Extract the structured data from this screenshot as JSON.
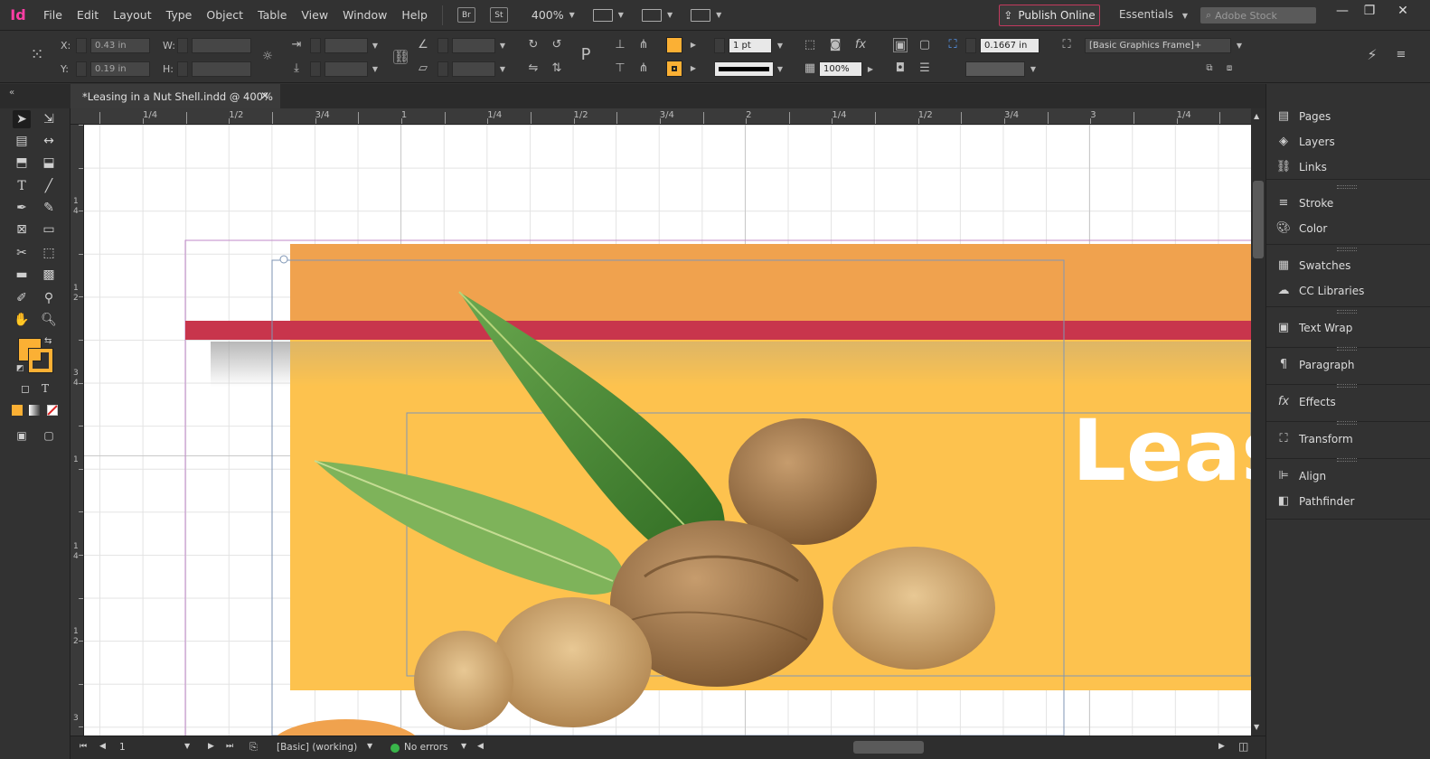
{
  "app": {
    "logo": "Id"
  },
  "menu": [
    "File",
    "Edit",
    "Layout",
    "Type",
    "Object",
    "Table",
    "View",
    "Window",
    "Help"
  ],
  "toolbar_top": {
    "bridge": "Br",
    "stock": "St",
    "zoom": "400%",
    "publish_label": "Publish Online",
    "workspace": "Essentials",
    "search_placeholder": "Adobe Stock"
  },
  "control": {
    "x_label": "X:",
    "y_label": "Y:",
    "w_label": "W:",
    "h_label": "H:",
    "x_value": "0.43 in",
    "y_value": "0.19 in",
    "stroke_weight": "1 pt",
    "opacity": "100%",
    "offset": "0.1667 in",
    "object_style": "[Basic Graphics Frame]+",
    "fill_color": "#fbb034"
  },
  "document": {
    "tab_title": "*Leasing in a Nut Shell.indd @ 400%",
    "canvas_text": "Leas"
  },
  "rulers": {
    "h_labels": [
      "1/4",
      "1/2",
      "3/4",
      "1",
      "1/4",
      "1/2",
      "3/4",
      "2",
      "1/4",
      "1/2",
      "3/4",
      "3",
      "1/4"
    ],
    "v_labels": [
      "1\n4",
      "1\n2",
      "3\n4",
      "1",
      "1\n4",
      "1\n2",
      "3"
    ]
  },
  "status": {
    "page": "1",
    "style": "[Basic] (working)",
    "preflight": "No errors",
    "preflight_color": "#39b54a"
  },
  "panels": [
    {
      "group": [
        {
          "label": "Pages",
          "icon": "pages-icon"
        },
        {
          "label": "Layers",
          "icon": "layers-icon"
        },
        {
          "label": "Links",
          "icon": "links-icon"
        }
      ]
    },
    {
      "group": [
        {
          "label": "Stroke",
          "icon": "stroke-icon"
        },
        {
          "label": "Color",
          "icon": "color-icon"
        }
      ]
    },
    {
      "group": [
        {
          "label": "Swatches",
          "icon": "swatches-icon"
        },
        {
          "label": "CC Libraries",
          "icon": "cc-libraries-icon"
        }
      ]
    },
    {
      "group": [
        {
          "label": "Text Wrap",
          "icon": "text-wrap-icon"
        }
      ]
    },
    {
      "group": [
        {
          "label": "Paragraph",
          "icon": "paragraph-icon"
        }
      ]
    },
    {
      "group": [
        {
          "label": "Effects",
          "icon": "effects-icon"
        }
      ]
    },
    {
      "group": [
        {
          "label": "Transform",
          "icon": "transform-icon"
        }
      ]
    },
    {
      "group": [
        {
          "label": "Align",
          "icon": "align-icon"
        },
        {
          "label": "Pathfinder",
          "icon": "pathfinder-icon"
        }
      ]
    }
  ],
  "colors": {
    "orange_band": "#f0a24e",
    "red_band": "#c8354c",
    "yellow_bg": "#fdc24e",
    "accent": "#ff3ea5"
  }
}
